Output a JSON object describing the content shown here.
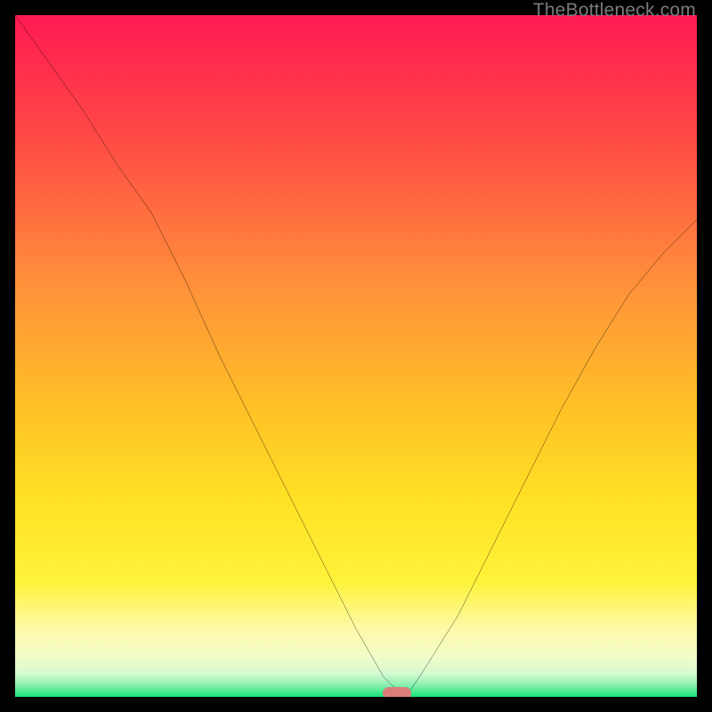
{
  "watermark": "TheBottleneck.com",
  "colors": {
    "frame": "#000000",
    "grad_top": "#ff1a52",
    "grad_mid_upper": "#ff6e3d",
    "grad_mid": "#ffc926",
    "grad_mid_lower": "#fff13a",
    "grad_pale": "#fdfbb8",
    "grad_pale2": "#effddb",
    "green": "#18e47a",
    "curve": "#000000",
    "marker": "#d97e7a"
  },
  "chart_data": {
    "type": "line",
    "title": "",
    "xlabel": "",
    "ylabel": "",
    "xlim": [
      0,
      100
    ],
    "ylim": [
      0,
      100
    ],
    "series": [
      {
        "name": "bottleneck-curve",
        "x": [
          0,
          5,
          10,
          15,
          20,
          25,
          30,
          35,
          40,
          45,
          50,
          54,
          56,
          58,
          60,
          65,
          70,
          75,
          80,
          85,
          90,
          95,
          100
        ],
        "y": [
          100,
          93,
          86,
          78,
          71,
          61,
          50,
          40,
          30,
          20,
          10,
          3,
          1,
          1,
          4,
          12,
          22,
          32,
          42,
          51,
          59,
          65,
          70
        ]
      }
    ],
    "marker": {
      "x": 56,
      "y": 0.5,
      "w": 4.2,
      "h": 1.8
    },
    "annotations": [
      {
        "text": "TheBottleneck.com",
        "role": "watermark",
        "pos": "top-right"
      }
    ]
  }
}
